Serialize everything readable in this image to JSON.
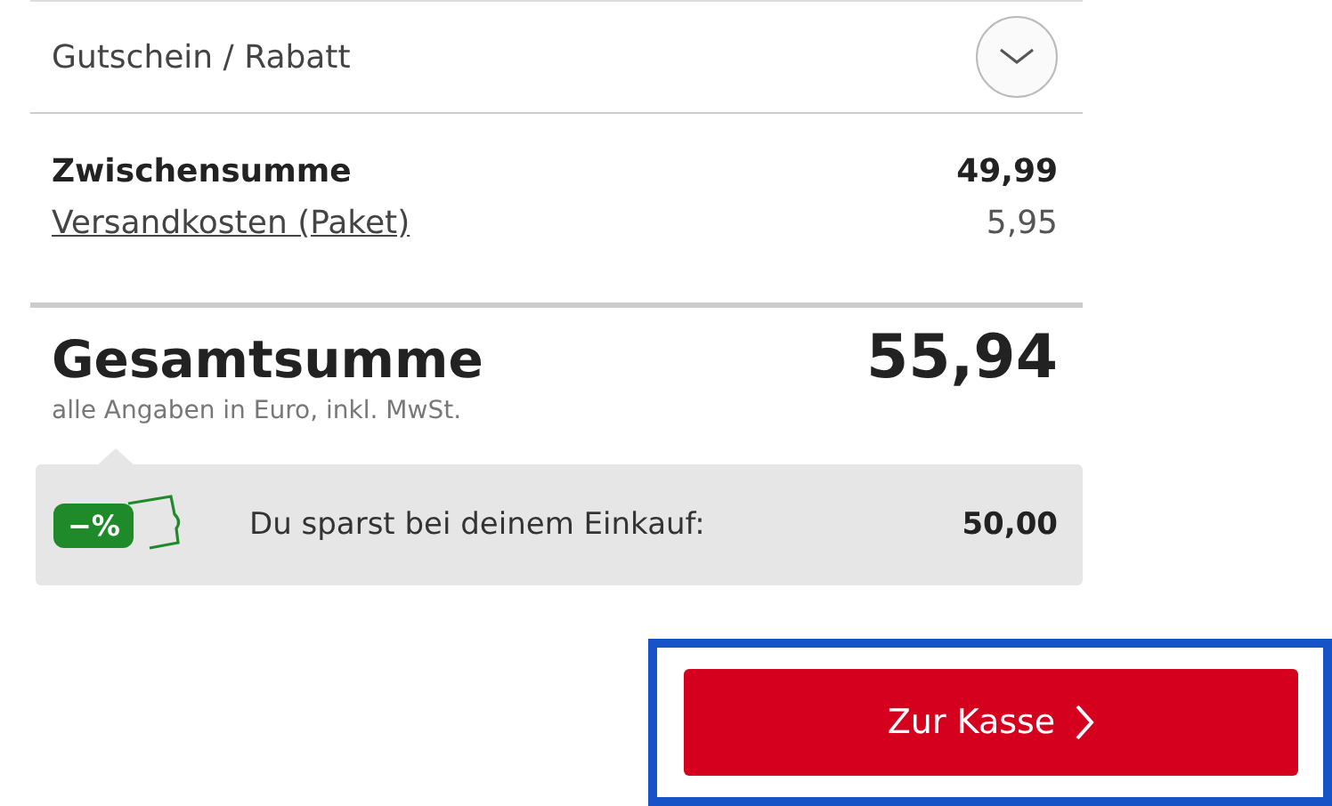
{
  "coupon": {
    "label": "Gutschein / Rabatt",
    "expanded": false
  },
  "subtotal": {
    "label": "Zwischensumme",
    "value": "49,99"
  },
  "shipping": {
    "label": "Versandkosten (Paket)",
    "value": "5,95"
  },
  "total": {
    "label": "Gesamtsumme",
    "value": "55,94",
    "note": "alle Angaben in Euro, inkl. MwSt."
  },
  "savings": {
    "badge": "−%",
    "label": "Du sparst bei deinem Einkauf:",
    "value": "50,00"
  },
  "checkout": {
    "label": "Zur Kasse",
    "highlighted": true
  }
}
